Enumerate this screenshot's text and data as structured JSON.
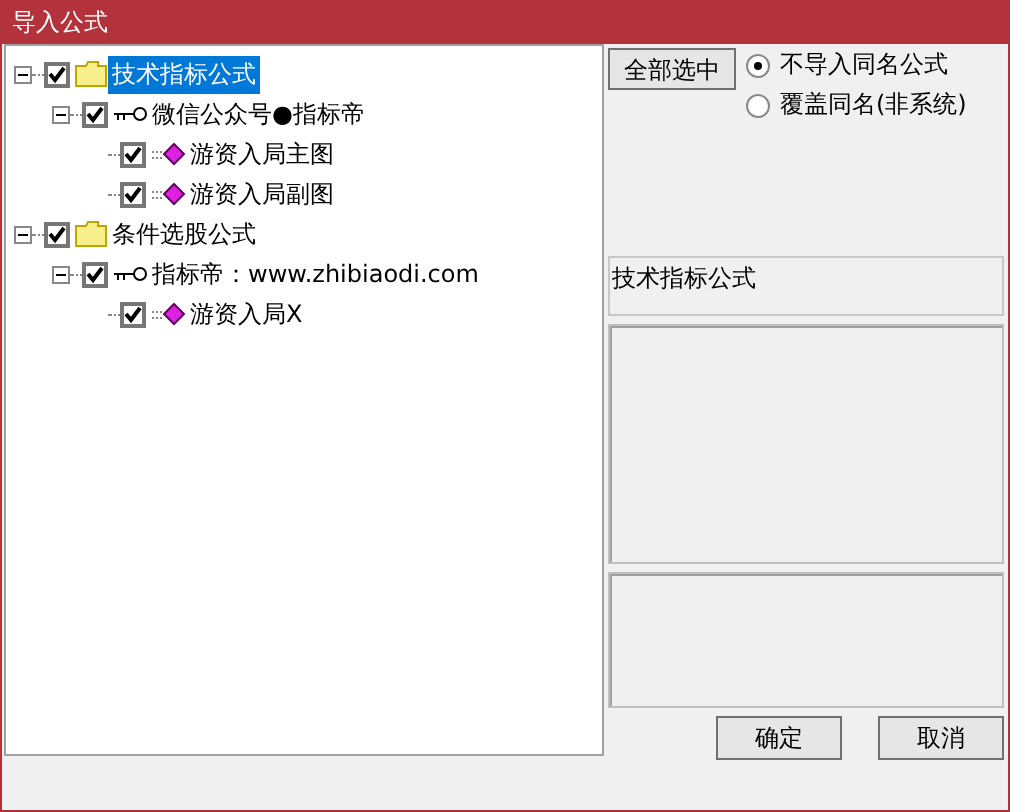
{
  "window": {
    "title": "导入公式"
  },
  "tree": [
    {
      "label": "技术指标公式",
      "kind": "folder",
      "checked": true,
      "selected": true,
      "expanded": true,
      "children": [
        {
          "label": "微信公众号●指标帝",
          "kind": "key",
          "checked": true,
          "selected": false,
          "expanded": true,
          "children": [
            {
              "label": "游资入局主图",
              "kind": "formula",
              "checked": true,
              "selected": false
            },
            {
              "label": "游资入局副图",
              "kind": "formula",
              "checked": true,
              "selected": false
            }
          ]
        }
      ]
    },
    {
      "label": "条件选股公式",
      "kind": "folder",
      "checked": true,
      "selected": false,
      "expanded": true,
      "children": [
        {
          "label": "指标帝：www.zhibiaodi.com",
          "kind": "key",
          "checked": true,
          "selected": false,
          "expanded": true,
          "children": [
            {
              "label": "游资入局X",
              "kind": "formula",
              "checked": true,
              "selected": false
            }
          ]
        }
      ]
    }
  ],
  "select_all_button": "全部选中",
  "options": [
    {
      "label": "不导入同名公式",
      "selected": true
    },
    {
      "label": "覆盖同名(非系统)",
      "selected": false
    }
  ],
  "category_field": {
    "value": "技术指标公式"
  },
  "buttons": [
    "确定",
    "取消"
  ]
}
